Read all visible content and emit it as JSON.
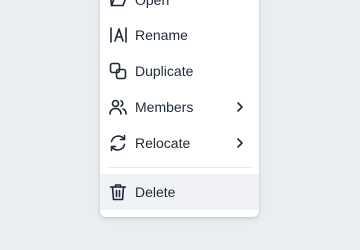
{
  "menu": {
    "items": [
      {
        "label": "Open",
        "icon": "open-folder-icon"
      },
      {
        "label": "Rename",
        "icon": "rename-cursor-icon"
      },
      {
        "label": "Duplicate",
        "icon": "duplicate-icon"
      },
      {
        "label": "Members",
        "icon": "members-icon",
        "submenu": true
      },
      {
        "label": "Relocate",
        "icon": "relocate-icon",
        "submenu": true
      }
    ],
    "danger_item": {
      "label": "Delete",
      "icon": "trash-icon"
    }
  },
  "colors": {
    "background": "#e9eef2",
    "menu_bg": "#ffffff",
    "text": "#1f2937",
    "hover_bg": "#f1f2f5"
  }
}
